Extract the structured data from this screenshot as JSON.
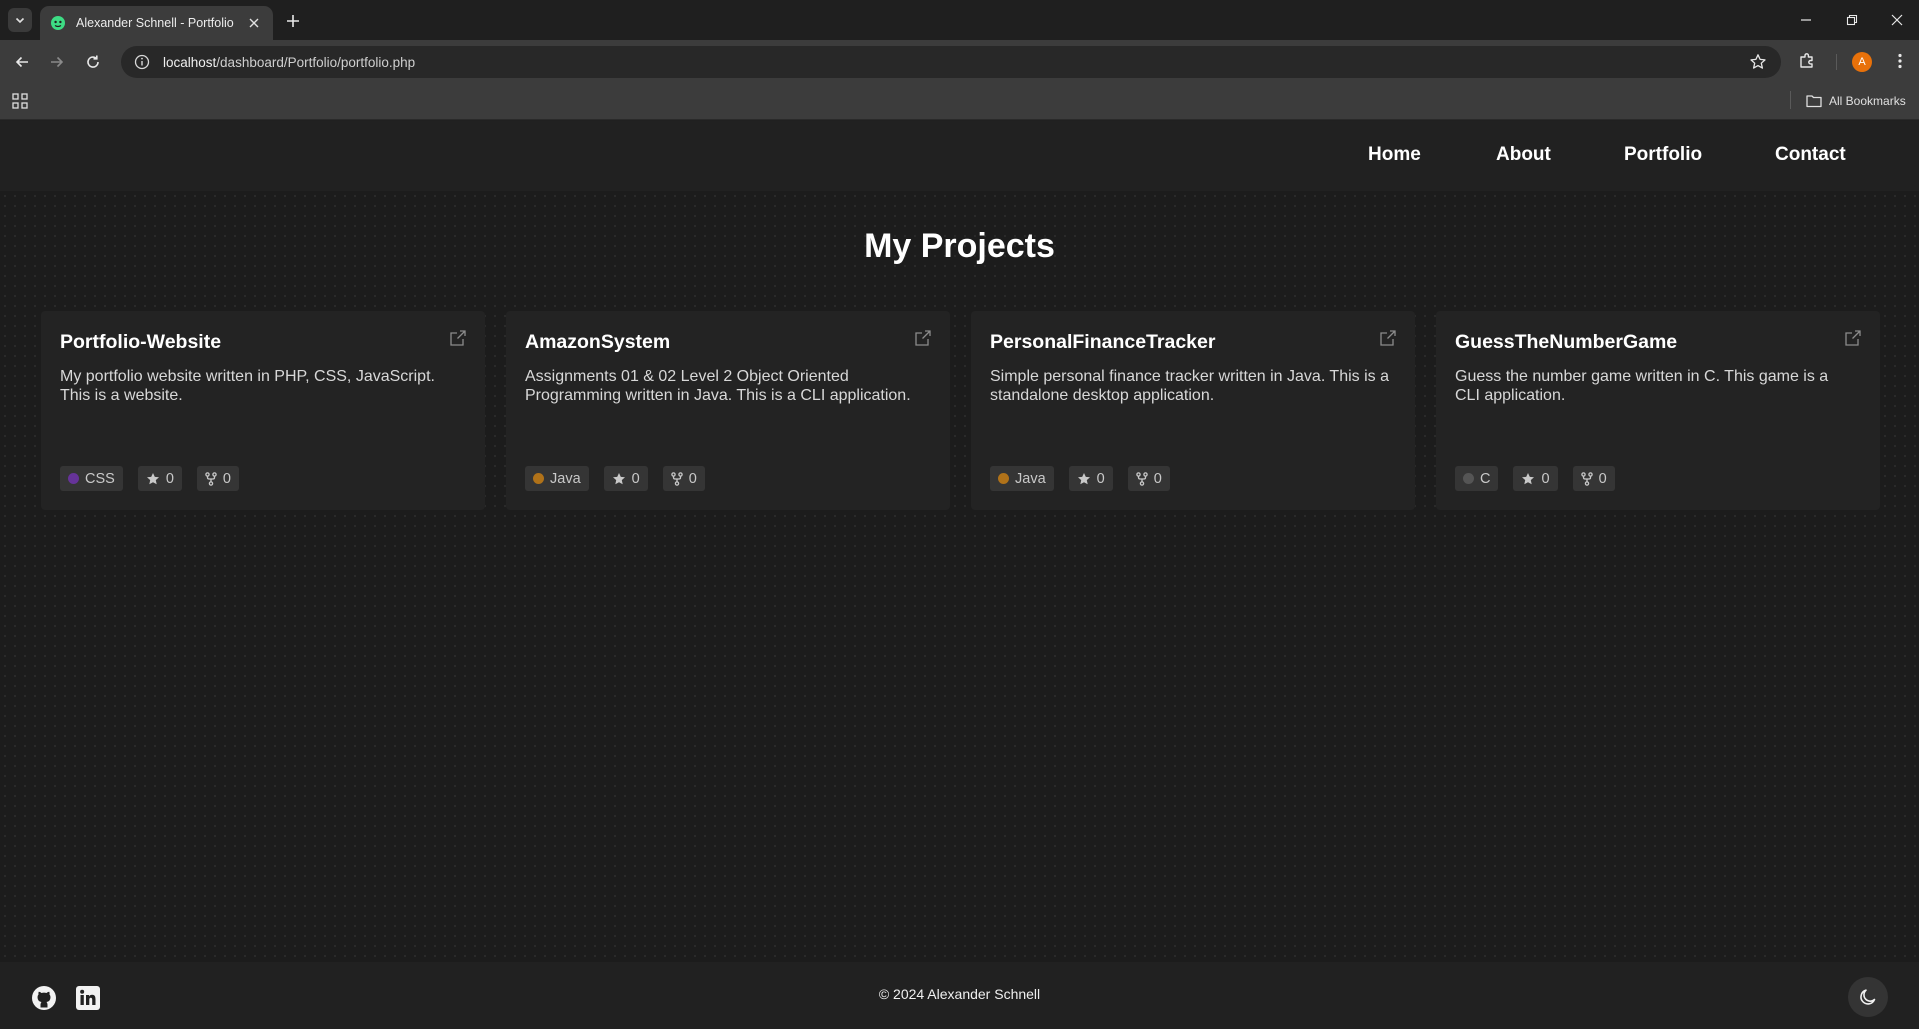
{
  "browser": {
    "tab": {
      "title": "Alexander Schnell - Portfolio"
    },
    "url": {
      "host": "localhost",
      "path": "/dashboard/Portfolio/portfolio.php"
    },
    "profile_initial": "A",
    "bookmarks": {
      "all_label": "All Bookmarks"
    }
  },
  "site": {
    "nav": [
      {
        "label": "Home"
      },
      {
        "label": "About"
      },
      {
        "label": "Portfolio"
      },
      {
        "label": "Contact"
      }
    ],
    "title": "My Projects",
    "projects": [
      {
        "name": "Portfolio-Website",
        "description": "My portfolio website written in PHP, CSS, JavaScript. This is a website.",
        "language": "CSS",
        "language_color": "#663399",
        "stars": "0",
        "forks": "0"
      },
      {
        "name": "AmazonSystem",
        "description": "Assignments 01 & 02 Level 2 Object Oriented Programming written in Java. This is a CLI application.",
        "language": "Java",
        "language_color": "#b07219",
        "stars": "0",
        "forks": "0"
      },
      {
        "name": "PersonalFinanceTracker",
        "description": "Simple personal finance tracker written in Java. This is a standalone desktop application.",
        "language": "Java",
        "language_color": "#b07219",
        "stars": "0",
        "forks": "0"
      },
      {
        "name": "GuessTheNumberGame",
        "description": "Guess the number game written in C. This game is a CLI application.",
        "language": "C",
        "language_color": "#555555",
        "stars": "0",
        "forks": "0"
      }
    ],
    "footer": {
      "copyright": "© 2024 Alexander Schnell"
    }
  }
}
